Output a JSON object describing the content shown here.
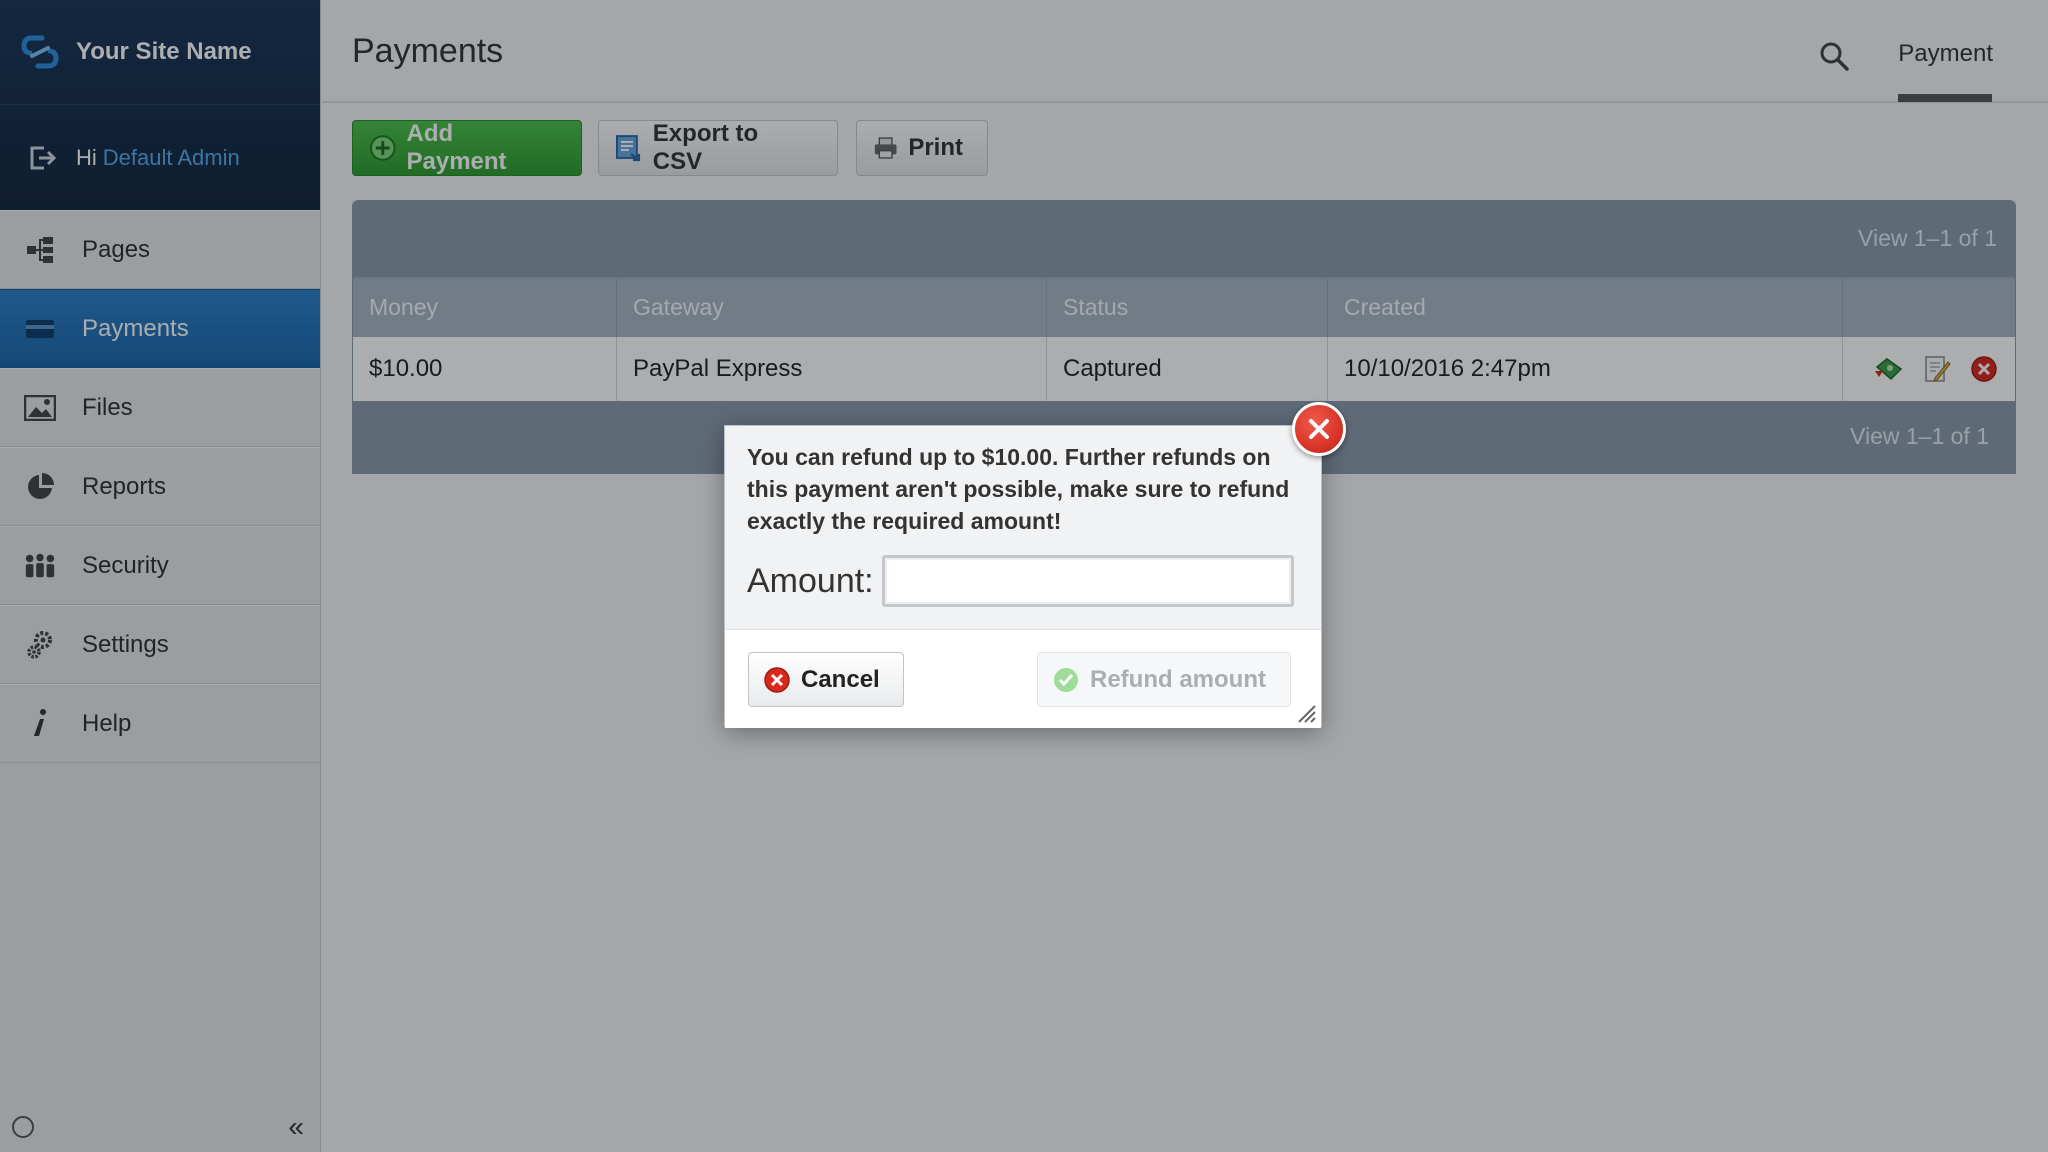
{
  "brand": {
    "site_name": "Your Site Name"
  },
  "user": {
    "greeting": "Hi",
    "name": "Default Admin"
  },
  "sidebar": {
    "items": [
      {
        "label": "Pages",
        "icon": "sitemap-icon",
        "active": false
      },
      {
        "label": "Payments",
        "icon": "credit-card-icon",
        "active": true
      },
      {
        "label": "Files",
        "icon": "image-icon",
        "active": false
      },
      {
        "label": "Reports",
        "icon": "pie-chart-icon",
        "active": false
      },
      {
        "label": "Security",
        "icon": "users-icon",
        "active": false
      },
      {
        "label": "Settings",
        "icon": "gears-icon",
        "active": false
      },
      {
        "label": "Help",
        "icon": "info-icon",
        "active": false
      }
    ],
    "collapse_label": "«"
  },
  "header": {
    "title": "Payments",
    "tab": "Payment"
  },
  "toolbar": {
    "add_label": "Add Payment",
    "export_label": "Export to CSV",
    "print_label": "Print"
  },
  "grid": {
    "view_count_top": "View 1–1 of 1",
    "view_count_bottom": "View 1–1 of 1",
    "columns": [
      "Money",
      "Gateway",
      "Status",
      "Created",
      ""
    ],
    "rows": [
      {
        "money": "$10.00",
        "gateway": "PayPal Express",
        "status": "Captured",
        "created": "10/10/2016 2:47pm"
      }
    ]
  },
  "dialog": {
    "message": "You can refund up to $10.00. Further refunds on this payment aren't possible, make sure to refund exactly the required amount!",
    "amount_label": "Amount:",
    "amount_value": "",
    "cancel_label": "Cancel",
    "refund_label": "Refund amount"
  },
  "colors": {
    "accent": "#1f6fb2",
    "primary_button": "#3aad39",
    "danger": "#d9291c",
    "sidebar_header": "#172d4a"
  }
}
